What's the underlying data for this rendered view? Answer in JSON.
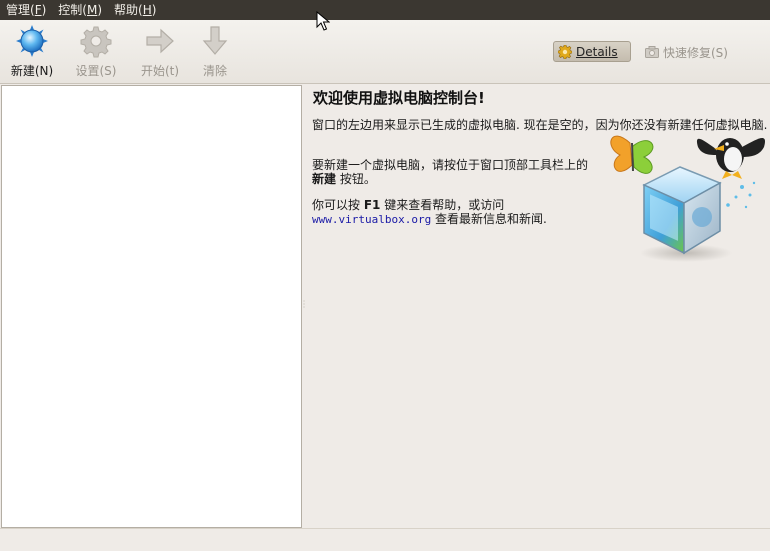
{
  "menubar": {
    "items": [
      {
        "label": "管理(",
        "mnemonic": "F",
        "suffix": ")"
      },
      {
        "label": "控制(",
        "mnemonic": "M",
        "suffix": ")"
      },
      {
        "label": "帮助(",
        "mnemonic": "H",
        "suffix": ")"
      }
    ]
  },
  "toolbar": {
    "new_label": "新建(N)",
    "settings_label": "设置(S)",
    "start_label": "开始(t)",
    "discard_label": "清除",
    "details_label": "Details",
    "snapshots_label": "快速修复(S)"
  },
  "welcome": {
    "title": "欢迎使用虚拟电脑控制台!",
    "p1": "窗口的左边用来显示已生成的虚拟电脑. 现在是空的，因为你还没有新建任何虚拟电脑.",
    "p2_a": "要新建一个虚拟电脑，请按位于窗口顶部工具栏上的 ",
    "p2_bold": "新建",
    "p2_b": " 按钮。",
    "p3_a": "你可以按 ",
    "p3_bold": "F1",
    "p3_b": " 键来查看帮助，或访问",
    "link": "www.virtualbox.org",
    "p3_c": " 查看最新信息和新闻."
  },
  "colors": {
    "menubar_bg": "#3b3731",
    "window_bg": "#efebe7",
    "link": "#1a1aa6"
  }
}
